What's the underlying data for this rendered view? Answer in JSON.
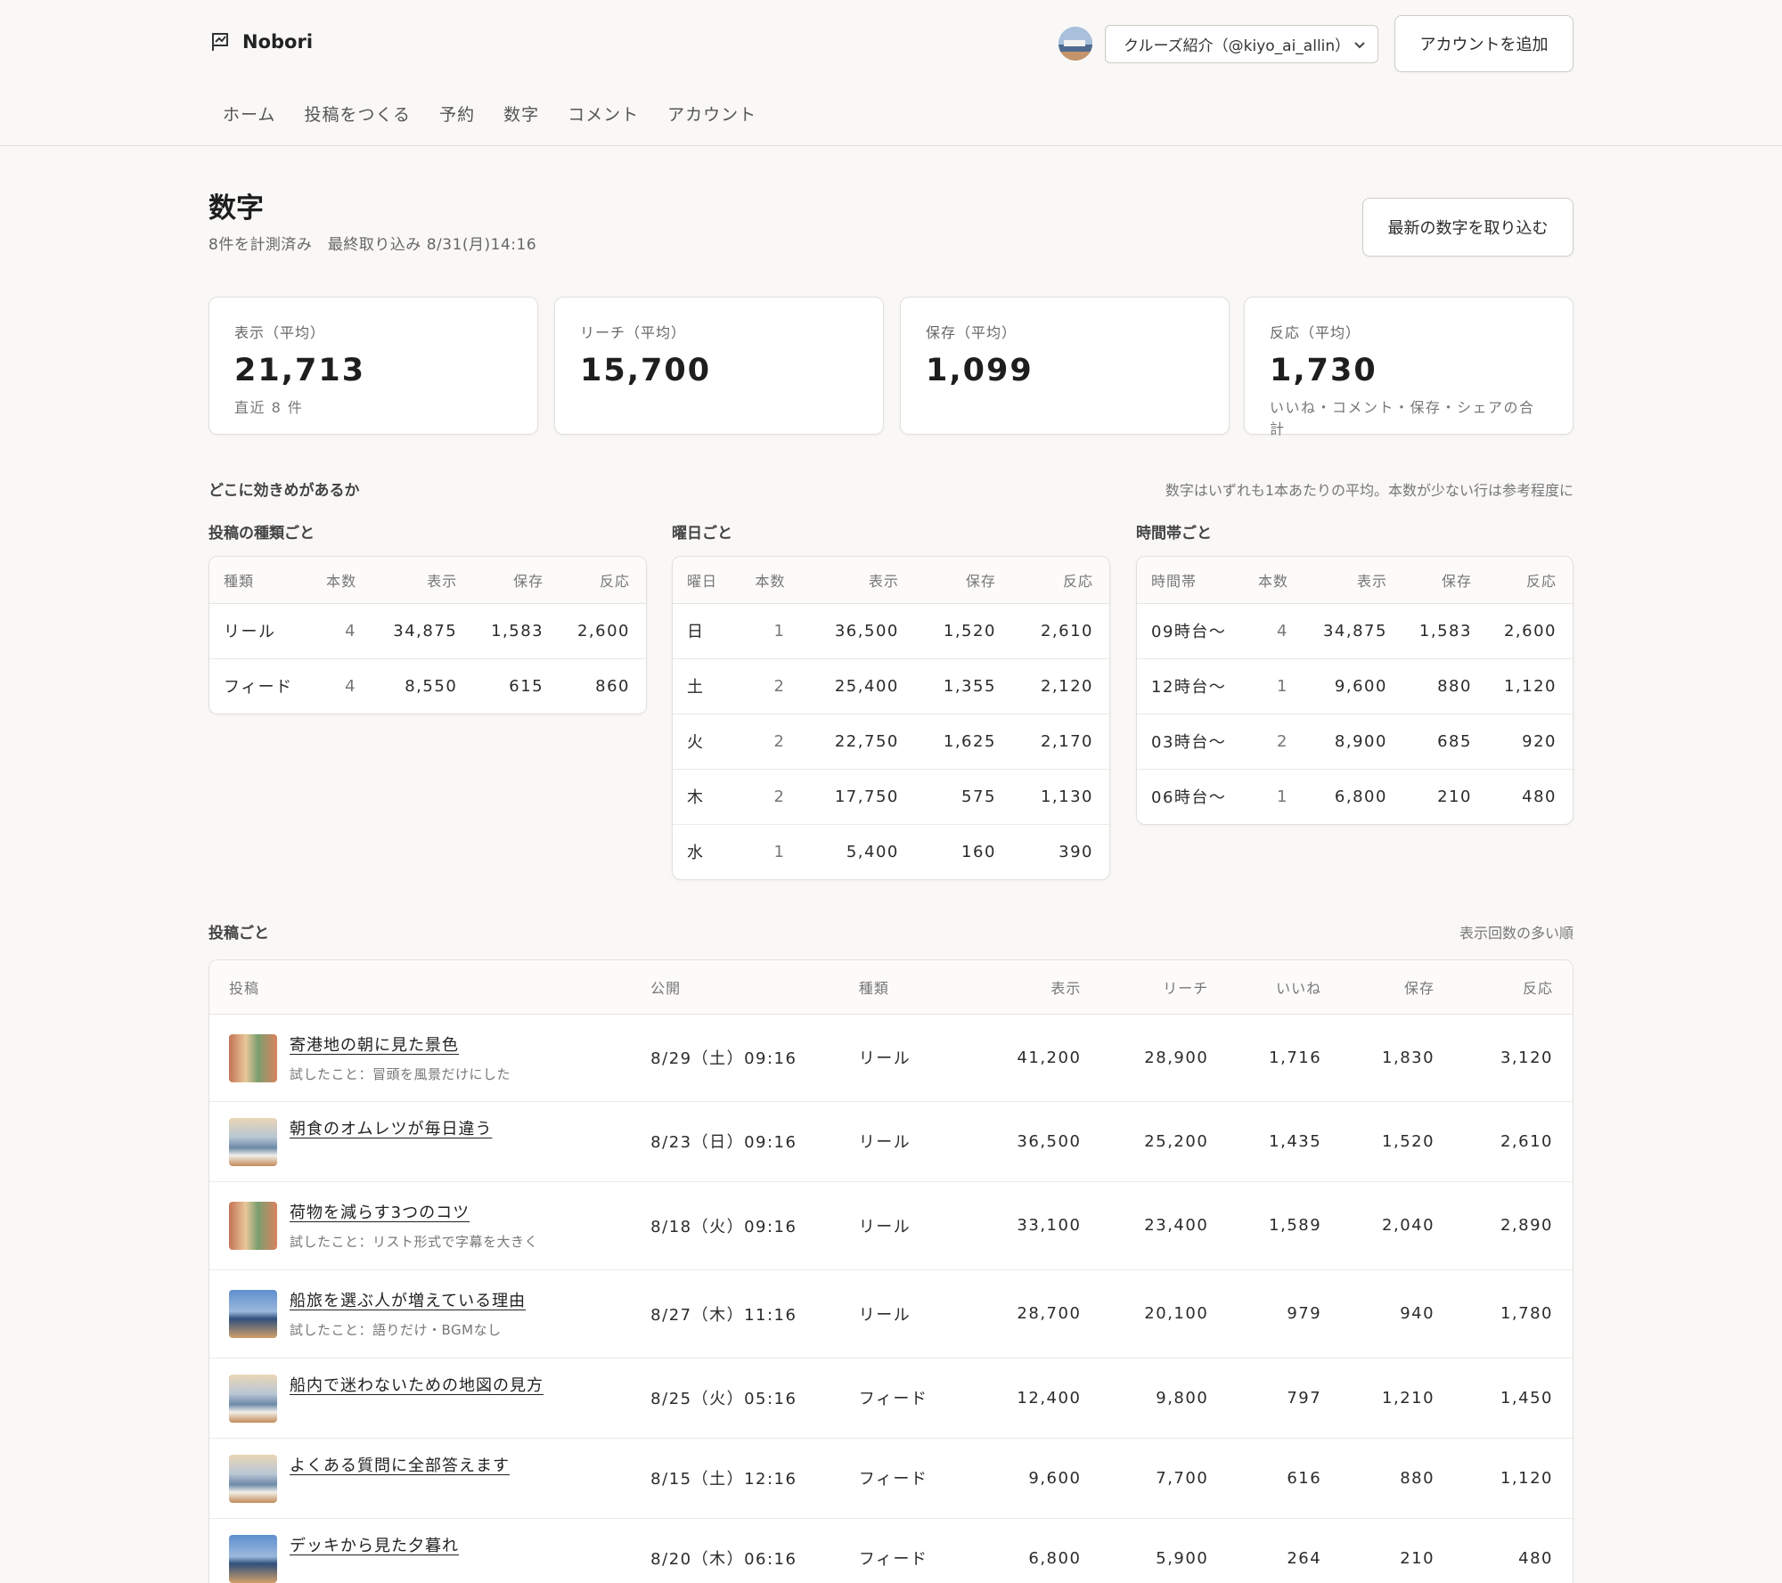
{
  "app": {
    "name": "Nobori"
  },
  "header": {
    "account_selected": "クルーズ紹介（@kiyo_ai_allin）",
    "add_account": "アカウントを追加"
  },
  "nav": [
    "ホーム",
    "投稿をつくる",
    "予約",
    "数字",
    "コメント",
    "アカウント"
  ],
  "page": {
    "title": "数字",
    "subtitle": "8件を計測済み　最終取り込み 8/31(月)14:16",
    "refresh_button": "最新の数字を取り込む"
  },
  "kpis": [
    {
      "label": "表示（平均）",
      "value": "21,713",
      "note": "直近 8 件"
    },
    {
      "label": "リーチ（平均）",
      "value": "15,700",
      "note": ""
    },
    {
      "label": "保存（平均）",
      "value": "1,099",
      "note": ""
    },
    {
      "label": "反応（平均）",
      "value": "1,730",
      "note": "いいね・コメント・保存・シェアの合計"
    }
  ],
  "effect": {
    "title": "どこに効きめがあるか",
    "note": "数字はいずれも1本あたりの平均。本数が少ない行は参考程度に"
  },
  "by_type": {
    "title": "投稿の種類ごと",
    "headers": [
      "種類",
      "本数",
      "表示",
      "保存",
      "反応"
    ],
    "rows": [
      [
        "リール",
        "4",
        "34,875",
        "1,583",
        "2,600"
      ],
      [
        "フィード",
        "4",
        "8,550",
        "615",
        "860"
      ]
    ]
  },
  "by_day": {
    "title": "曜日ごと",
    "headers": [
      "曜日",
      "本数",
      "表示",
      "保存",
      "反応"
    ],
    "rows": [
      [
        "日",
        "1",
        "36,500",
        "1,520",
        "2,610"
      ],
      [
        "土",
        "2",
        "25,400",
        "1,355",
        "2,120"
      ],
      [
        "火",
        "2",
        "22,750",
        "1,625",
        "2,170"
      ],
      [
        "木",
        "2",
        "17,750",
        "575",
        "1,130"
      ],
      [
        "水",
        "1",
        "5,400",
        "160",
        "390"
      ]
    ]
  },
  "by_hour": {
    "title": "時間帯ごと",
    "headers": [
      "時間帯",
      "本数",
      "表示",
      "保存",
      "反応"
    ],
    "rows": [
      [
        "09時台〜",
        "4",
        "34,875",
        "1,583",
        "2,600"
      ],
      [
        "12時台〜",
        "1",
        "9,600",
        "880",
        "1,120"
      ],
      [
        "03時台〜",
        "2",
        "8,900",
        "685",
        "920"
      ],
      [
        "06時台〜",
        "1",
        "6,800",
        "210",
        "480"
      ]
    ]
  },
  "posts": {
    "title": "投稿ごと",
    "sort_note": "表示回数の多い順",
    "headers": [
      "投稿",
      "公開",
      "種類",
      "表示",
      "リーチ",
      "いいね",
      "保存",
      "反応"
    ],
    "rows": [
      {
        "title": "寄港地の朝に見た景色",
        "sub": "試したこと：冒頭を風景だけにした",
        "date": "8/29（土）09:16",
        "type": "リール",
        "views": "41,200",
        "reach": "28,900",
        "likes": "1,716",
        "saves": "1,830",
        "reactions": "3,120"
      },
      {
        "title": "朝食のオムレツが毎日違う",
        "sub": "",
        "date": "8/23（日）09:16",
        "type": "リール",
        "views": "36,500",
        "reach": "25,200",
        "likes": "1,435",
        "saves": "1,520",
        "reactions": "2,610"
      },
      {
        "title": "荷物を減らす3つのコツ",
        "sub": "試したこと：リスト形式で字幕を大きく",
        "date": "8/18（火）09:16",
        "type": "リール",
        "views": "33,100",
        "reach": "23,400",
        "likes": "1,589",
        "saves": "2,040",
        "reactions": "2,890"
      },
      {
        "title": "船旅を選ぶ人が増えている理由",
        "sub": "試したこと：語りだけ・BGMなし",
        "date": "8/27（木）11:16",
        "type": "リール",
        "views": "28,700",
        "reach": "20,100",
        "likes": "979",
        "saves": "940",
        "reactions": "1,780"
      },
      {
        "title": "船内で迷わないための地図の見方",
        "sub": "",
        "date": "8/25（火）05:16",
        "type": "フィード",
        "views": "12,400",
        "reach": "9,800",
        "likes": "797",
        "saves": "1,210",
        "reactions": "1,450"
      },
      {
        "title": "よくある質問に全部答えます",
        "sub": "",
        "date": "8/15（土）12:16",
        "type": "フィード",
        "views": "9,600",
        "reach": "7,700",
        "likes": "616",
        "saves": "880",
        "reactions": "1,120"
      },
      {
        "title": "デッキから見た夕暮れ",
        "sub": "",
        "date": "8/20（木）06:16",
        "type": "フィード",
        "views": "6,800",
        "reach": "5,900",
        "likes": "264",
        "saves": "210",
        "reactions": "480"
      }
    ]
  }
}
